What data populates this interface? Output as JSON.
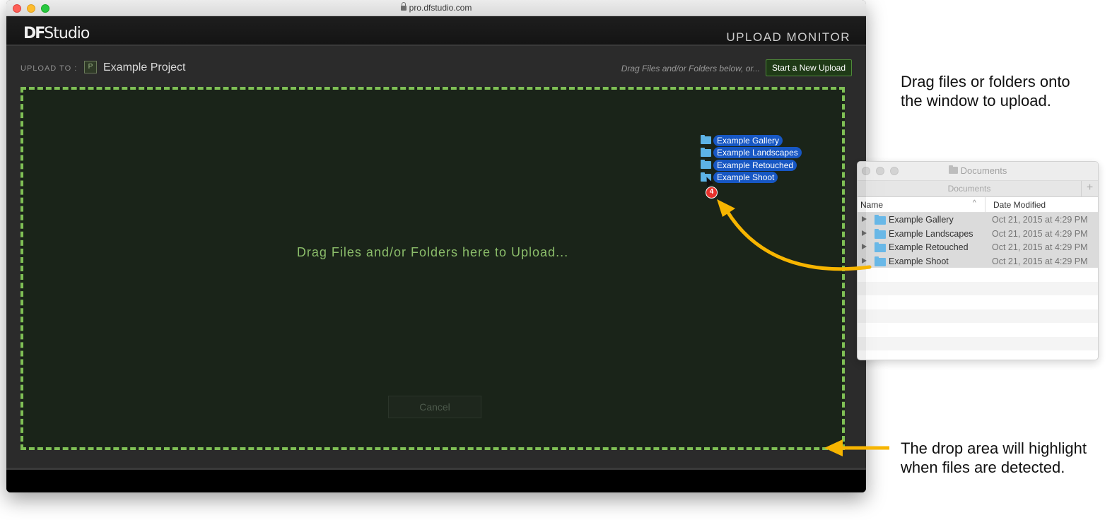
{
  "browser": {
    "url": "pro.dfstudio.com"
  },
  "app": {
    "logo_df": "DF",
    "logo_studio": "Studio",
    "title": "UPLOAD MONITOR"
  },
  "upload_bar": {
    "label": "UPLOAD TO :",
    "project_badge": "P",
    "project_name": "Example Project",
    "hint": "Drag Files and/or Folders below, or...",
    "start_button": "Start a New Upload"
  },
  "drop_area": {
    "message": "Drag Files and/or Folders here to Upload...",
    "cancel_button": "Cancel"
  },
  "dragged_items": [
    {
      "name": "Example Gallery"
    },
    {
      "name": "Example Landscapes"
    },
    {
      "name": "Example Retouched"
    },
    {
      "name": "Example Shoot"
    }
  ],
  "drag_count": "4",
  "finder": {
    "title": "Documents",
    "tab": "Documents",
    "plus": "+",
    "col_name": "Name",
    "sort_indicator": "^",
    "col_date": "Date Modified",
    "rows": [
      {
        "name": "Example Gallery",
        "date": "Oct 21, 2015 at 4:29 PM"
      },
      {
        "name": "Example Landscapes",
        "date": "Oct 21, 2015 at 4:29 PM"
      },
      {
        "name": "Example Retouched",
        "date": "Oct 21, 2015 at 4:29 PM"
      },
      {
        "name": "Example Shoot",
        "date": "Oct 21, 2015 at 4:29 PM"
      }
    ]
  },
  "annotations": {
    "top": "Drag files or folders onto the window to upload.",
    "bottom": "The drop area will highlight when files are detected."
  },
  "colors": {
    "accent_green": "#7fbf55",
    "arrow_yellow": "#f7b500",
    "selection_blue": "#1757c4"
  }
}
